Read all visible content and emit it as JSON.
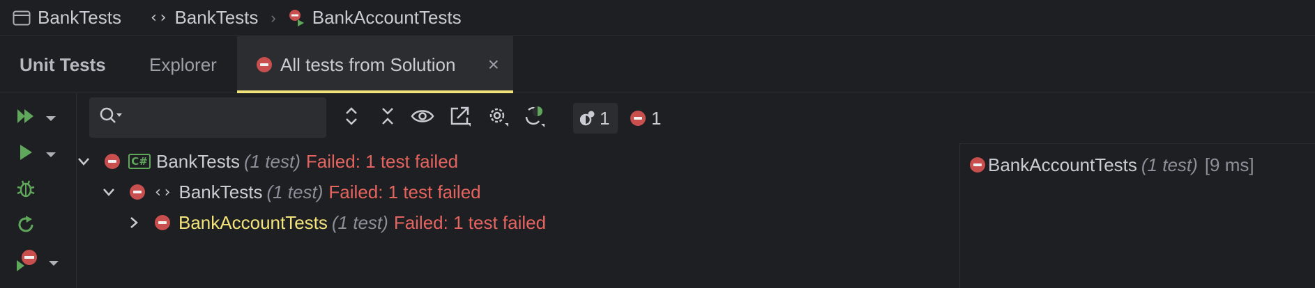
{
  "breadcrumb": {
    "project": "BankTests",
    "namespace": "BankTests",
    "class": "BankAccountTests"
  },
  "tabs": {
    "title": "Unit Tests",
    "explorer": "Explorer",
    "active_session": "All tests from Solution",
    "close_glyph": "×"
  },
  "search": {
    "value": "",
    "placeholder": ""
  },
  "counters": {
    "in_progress": "1",
    "failed": "1"
  },
  "tree": [
    {
      "name": "BankTests",
      "count": "(1 test)",
      "status": "Failed: 1 test failed",
      "kind": "csharp-project",
      "expanded": true
    },
    {
      "name": "BankTests",
      "count": "(1 test)",
      "status": "Failed: 1 test failed",
      "kind": "namespace",
      "expanded": true
    },
    {
      "name": "BankAccountTests",
      "count": "(1 test)",
      "status": "Failed: 1 test failed",
      "kind": "class",
      "expanded": false
    }
  ],
  "cs_badge": "C#",
  "details": {
    "name": "BankAccountTests",
    "count": "(1 test)",
    "duration": "[9 ms]"
  },
  "icons": {
    "window": "window-icon",
    "braces": "namespace-braces-icon",
    "failed_run": "failed-run-icon",
    "run_all": "run-all-icon",
    "run": "run-icon",
    "debug": "debug-icon",
    "rerun": "rerun-icon",
    "run_failed": "run-failed-icon",
    "expand_all": "expand-all-icon",
    "collapse_all": "collapse-all-icon",
    "show": "eye-icon",
    "export": "export-icon",
    "settings": "gear-icon",
    "auto_rerun": "continuous-testing-icon"
  },
  "colors": {
    "accent_tab": "#f2e37a",
    "failed": "#e5645f",
    "run_green": "#5fa85b",
    "highlight": "#f2e37a"
  }
}
